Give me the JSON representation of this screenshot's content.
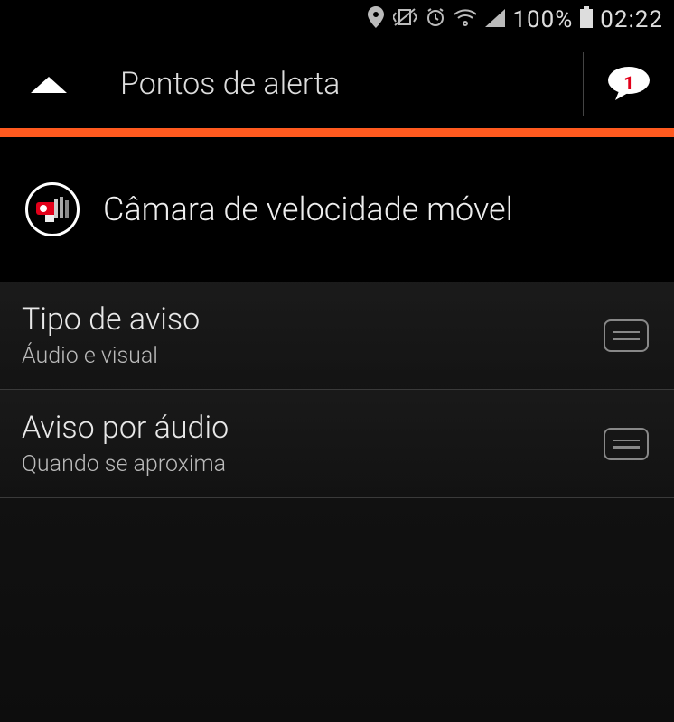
{
  "status_bar": {
    "battery_pct": "100%",
    "time": "02:22"
  },
  "header": {
    "title": "Pontos de alerta",
    "chat_badge": "1"
  },
  "section": {
    "title": "Câmara de velocidade móvel"
  },
  "settings": [
    {
      "title": "Tipo de aviso",
      "subtitle": "Áudio e visual"
    },
    {
      "title": "Aviso por áudio",
      "subtitle": "Quando se aproxima"
    }
  ]
}
